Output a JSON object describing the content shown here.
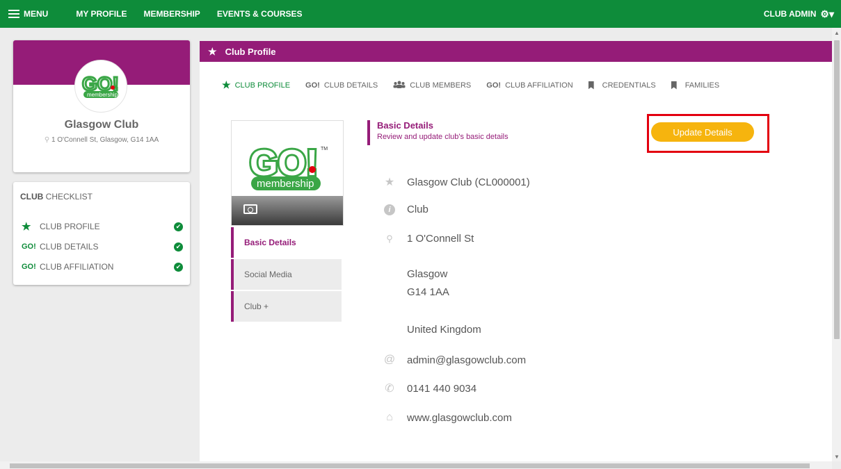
{
  "topnav": {
    "menu_label": "MENU",
    "links": [
      "MY PROFILE",
      "MEMBERSHIP",
      "EVENTS & COURSES"
    ],
    "admin_label": "CLUB ADMIN"
  },
  "profile": {
    "name": "Glasgow Club",
    "address": "1 O'Connell St, Glasgow, G14 1AA"
  },
  "checklist": {
    "title_bold": "CLUB",
    "title_rest": " CHECKLIST",
    "items": [
      {
        "icon": "★",
        "label": "CLUB PROFILE"
      },
      {
        "icon": "GO!",
        "label": "CLUB DETAILS"
      },
      {
        "icon": "GO!",
        "label": "CLUB AFFILIATION"
      }
    ]
  },
  "main": {
    "header_title": "Club Profile",
    "tabs": [
      {
        "icon": "★",
        "label": "CLUB PROFILE"
      },
      {
        "icon": "GO!",
        "label": "CLUB DETAILS"
      },
      {
        "icon": "people",
        "label": "CLUB MEMBERS"
      },
      {
        "icon": "GO!",
        "label": "CLUB AFFILIATION"
      },
      {
        "icon": "bookmark",
        "label": "CREDENTIALS"
      },
      {
        "icon": "bookmark",
        "label": "FAMILIES"
      }
    ],
    "side_tabs": [
      "Basic Details",
      "Social Media",
      "Club +"
    ],
    "section_title": "Basic Details",
    "section_subtitle": "Review and update club's basic details",
    "update_button": "Update Details",
    "details": {
      "name": "Glasgow Club (CL000001)",
      "type": "Club",
      "street": "1 O'Connell St",
      "city": "Glasgow",
      "postcode": "G14 1AA",
      "country": "United Kingdom",
      "email": "admin@glasgowclub.com",
      "phone": "0141 440 9034",
      "website": "www.glasgowclub.com"
    }
  },
  "colors": {
    "brand_green": "#0e8c3a",
    "brand_purple": "#951c78",
    "button_yellow": "#f6b40e",
    "highlight_red": "#e3000f"
  }
}
